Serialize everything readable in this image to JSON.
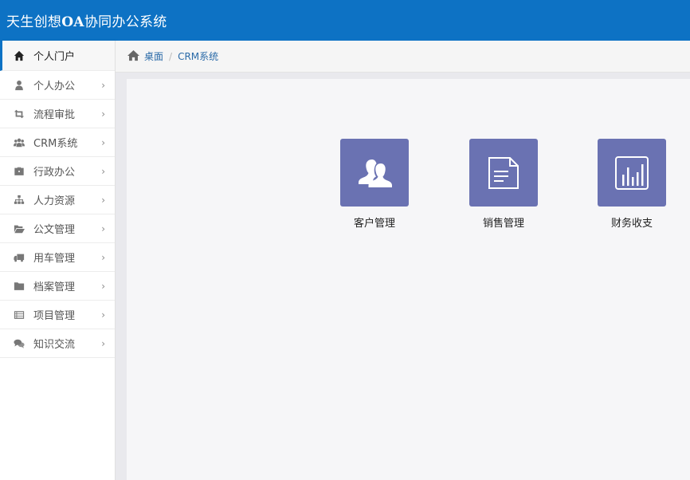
{
  "header": {
    "title_pre": "天生创想",
    "title_oa": "OA",
    "title_post": "协同办公系统"
  },
  "sidebar": {
    "items": [
      {
        "label": "个人门户",
        "icon": "home-icon"
      },
      {
        "label": "个人办公",
        "icon": "user-icon"
      },
      {
        "label": "流程审批",
        "icon": "retweet-icon"
      },
      {
        "label": "CRM系统",
        "icon": "users-icon"
      },
      {
        "label": "行政办公",
        "icon": "briefcase-icon"
      },
      {
        "label": "人力资源",
        "icon": "sitemap-icon"
      },
      {
        "label": "公文管理",
        "icon": "folder-open-icon"
      },
      {
        "label": "用车管理",
        "icon": "truck-icon"
      },
      {
        "label": "档案管理",
        "icon": "folder-icon"
      },
      {
        "label": "项目管理",
        "icon": "list-icon"
      },
      {
        "label": "知识交流",
        "icon": "comments-icon"
      }
    ],
    "chevron": "›"
  },
  "breadcrumb": {
    "home": "桌面",
    "separator": "/",
    "current": "CRM系统"
  },
  "tiles": [
    {
      "label": "客户管理",
      "icon": "customer-icon"
    },
    {
      "label": "销售管理",
      "icon": "document-icon"
    },
    {
      "label": "财务收支",
      "icon": "bar-chart-icon"
    }
  ],
  "colors": {
    "header": "#0d72c4",
    "tile": "#6a72b2",
    "link": "#2a6aa8"
  }
}
